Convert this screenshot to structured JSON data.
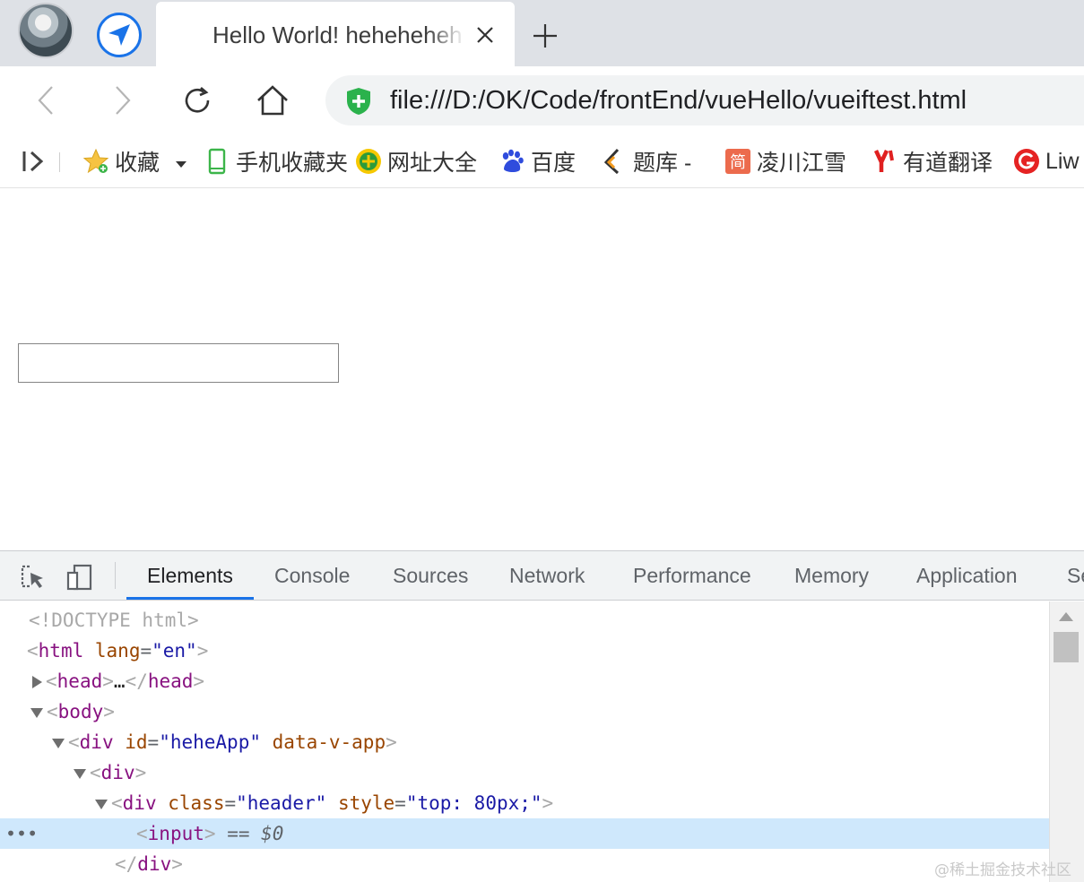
{
  "browser": {
    "tab_title": "Hello World! heheheheh",
    "address_url": "file:///D:/OK/Code/frontEnd/vueHello/vueiftest.html"
  },
  "bookmarks": [
    {
      "label": "收藏",
      "icon": "star-icon"
    },
    {
      "label": "手机收藏夹",
      "icon": "phone-icon"
    },
    {
      "label": "网址大全",
      "icon": "add-circle-icon"
    },
    {
      "label": "百度",
      "icon": "baidu-paw-icon"
    },
    {
      "label": "题库 -",
      "icon": "tiku-icon"
    },
    {
      "label": "凌川江雪",
      "icon": "jian-icon"
    },
    {
      "label": "有道翻译",
      "icon": "youdao-icon"
    },
    {
      "label": "Liw",
      "icon": "g-circle-icon"
    }
  ],
  "page": {
    "input_value": ""
  },
  "devtools": {
    "tabs": [
      "Elements",
      "Console",
      "Sources",
      "Network",
      "Performance",
      "Memory",
      "Application",
      "Se"
    ],
    "active_tab": "Elements",
    "dom": {
      "doctype": "<!DOCTYPE html>",
      "html_tag": "html",
      "lang_attr": "lang",
      "lang_val": "\"en\"",
      "head_tag": "head",
      "head_ellipsis": "…",
      "body_tag": "body",
      "div_tag": "div",
      "id_attr": "id",
      "id_val": "\"heheApp\"",
      "data_attr": "data-v-app",
      "class_attr": "class",
      "class_val": "\"header\"",
      "style_attr": "style",
      "style_val": "\"top: 80px;\"",
      "input_tag": "input",
      "selected_marker": "== $0",
      "close_div": "div",
      "dots": "•••"
    }
  },
  "watermark": "@稀土掘金技术社区"
}
